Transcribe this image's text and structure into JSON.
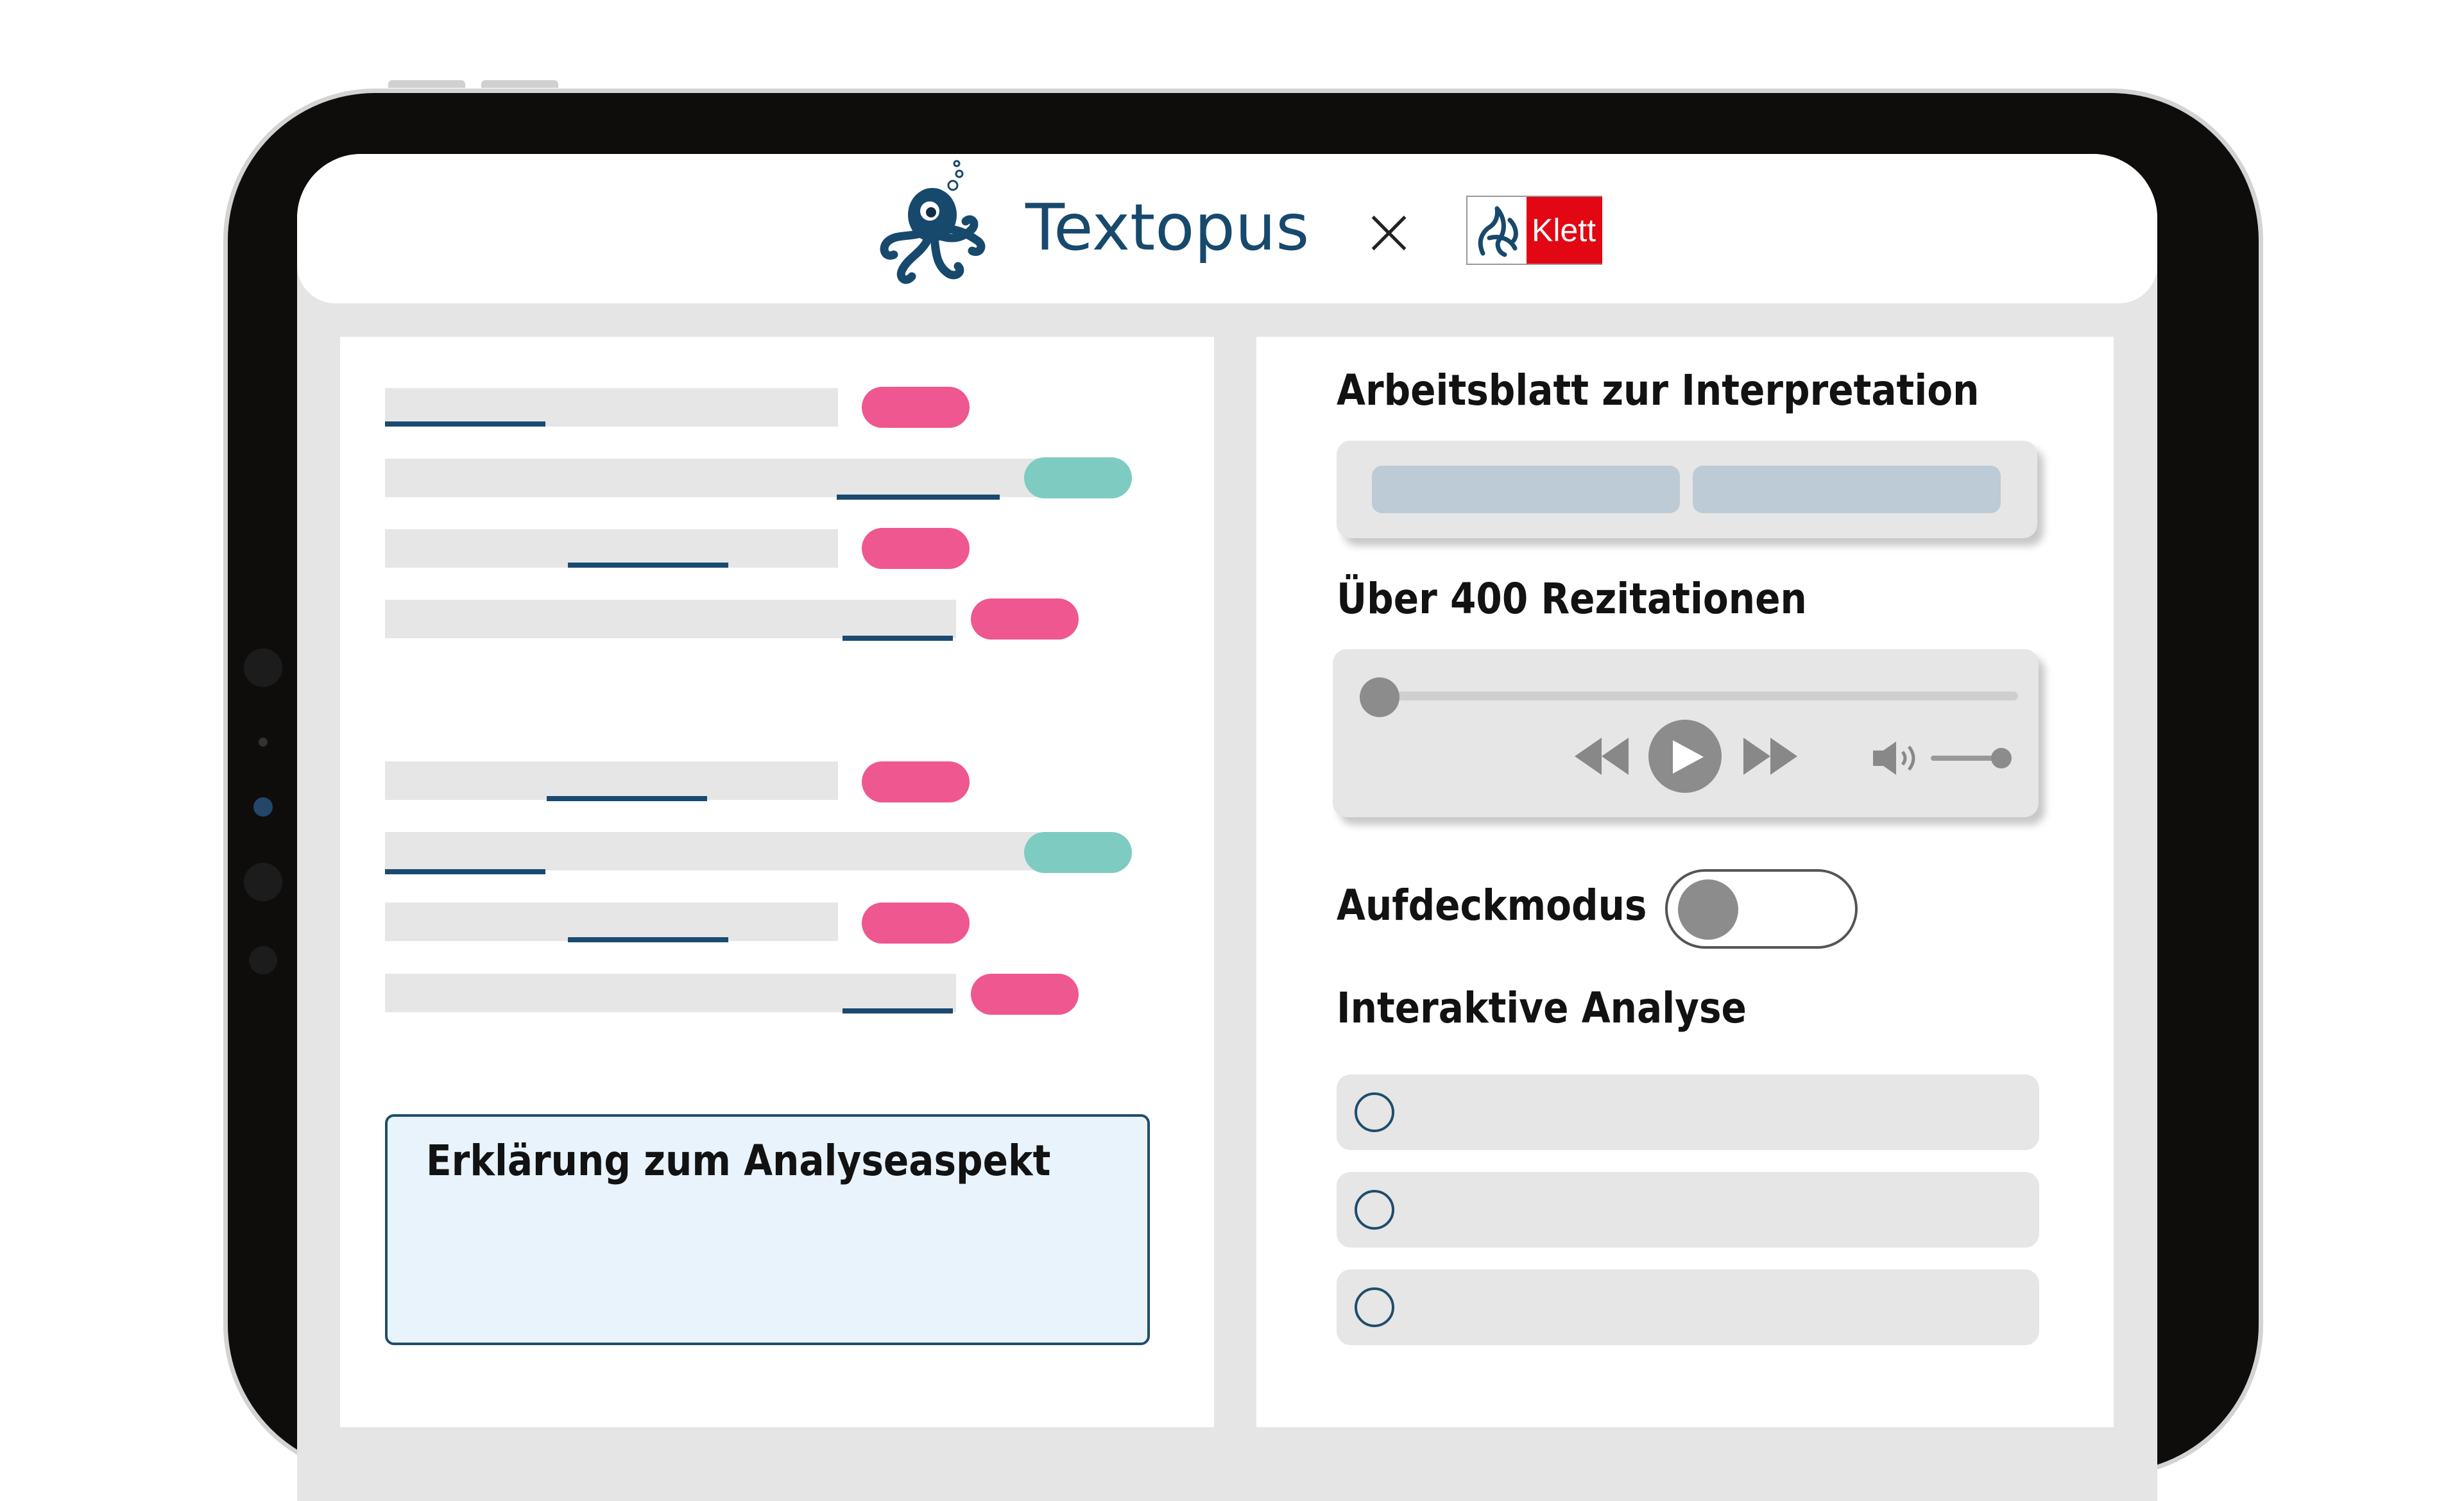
{
  "header": {
    "brand_name": "Textopus",
    "separator": "×",
    "partner_logo_text": "Klett",
    "colors": {
      "brand": "#17496d",
      "partner_red": "#e30613"
    }
  },
  "left_panel": {
    "explanation_box": {
      "title": "Erklärung zum Analyseaspekt"
    },
    "annotation_rows": [
      {
        "tag_color": "pink"
      },
      {
        "tag_color": "teal"
      },
      {
        "tag_color": "pink"
      },
      {
        "tag_color": "pink"
      },
      {
        "tag_color": "pink"
      },
      {
        "tag_color": "teal"
      },
      {
        "tag_color": "pink"
      },
      {
        "tag_color": "pink"
      }
    ],
    "colors": {
      "pink": "#ef5790",
      "teal": "#7ecbc2",
      "underline": "#1a4a70"
    }
  },
  "right_panel": {
    "worksheet": {
      "title": "Arbeitsblatt zur Interpretation",
      "buttons": 2
    },
    "recitations": {
      "title": "Über 400 Rezitationen",
      "player": {
        "progress": 0,
        "volume": 1,
        "icons": [
          "rewind-icon",
          "play-icon",
          "fast-forward-icon",
          "speaker-icon"
        ]
      }
    },
    "reveal_mode": {
      "label": "Aufdeckmodus",
      "enabled": false
    },
    "interactive_analysis": {
      "title": "Interaktive Analyse",
      "option_count": 3
    }
  }
}
